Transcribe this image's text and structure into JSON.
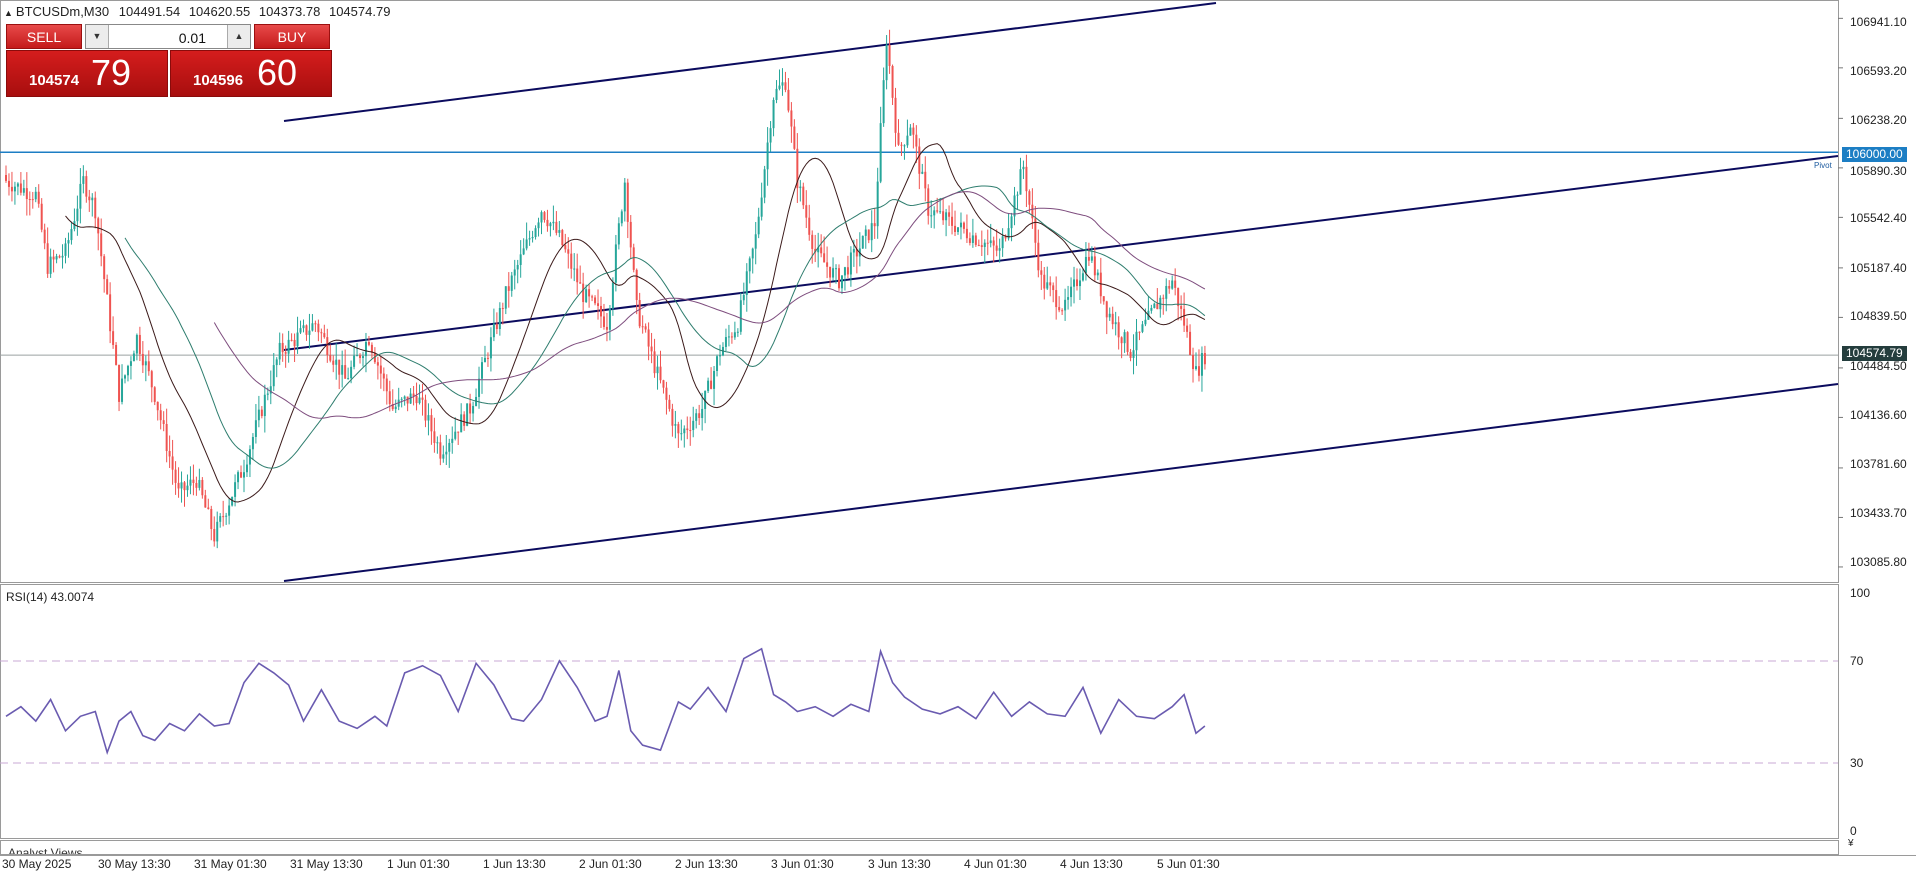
{
  "header": {
    "symbol": "BTCUSDm,M30",
    "collapse_icon": "triangle-up-icon",
    "ohlc": [
      "104491.54",
      "104620.55",
      "104373.78",
      "104574.79"
    ]
  },
  "trade_panel": {
    "sell_label": "SELL",
    "buy_label": "BUY",
    "lot_value": "0.01",
    "bid_small": "104574",
    "bid_big": "79",
    "ask_small": "104596",
    "ask_big": "60"
  },
  "colors": {
    "bull": "#26a69a",
    "bear": "#ef5350",
    "channel": "#0b0b5e",
    "pivot": "#1c7ec4",
    "ma_fast": "#3b1a1a",
    "ma_mid": "#2e7d6e",
    "ma_slow": "#7e4d7e",
    "rsi": "#6a5bb0",
    "current_price_tag": "#243d3d",
    "pivot_tag": "#1c7ec4"
  },
  "price_axis": {
    "labels": [
      "106941.10",
      "106593.20",
      "106238.20",
      "105890.30",
      "105542.40",
      "105187.40",
      "104839.50",
      "104484.50",
      "104136.60",
      "103781.60",
      "103433.70",
      "103085.80"
    ],
    "current_price": "104574.79",
    "pivot_price": "106000.00",
    "pivot_label": "Pivot"
  },
  "time_axis": {
    "labels": [
      "30 May 2025",
      "30 May 13:30",
      "31 May 01:30",
      "31 May 13:30",
      "1 Jun 01:30",
      "1 Jun 13:30",
      "2 Jun 01:30",
      "2 Jun 13:30",
      "3 Jun 01:30",
      "3 Jun 13:30",
      "4 Jun 01:30",
      "4 Jun 13:30",
      "5 Jun 01:30"
    ]
  },
  "rsi": {
    "title": "RSI(14) 43.0074",
    "levels": [
      "100",
      "70",
      "30",
      "0"
    ]
  },
  "bottom_tab": {
    "label": "Analyst Views"
  },
  "chart_data": [
    {
      "type": "candlestick",
      "title": "BTCUSDm,M30",
      "ylim": [
        102980,
        107070
      ],
      "key_closes": [
        [
          0,
          105800
        ],
        [
          10,
          105700
        ],
        [
          14,
          105200
        ],
        [
          20,
          105300
        ],
        [
          26,
          105800
        ],
        [
          30,
          105600
        ],
        [
          38,
          104300
        ],
        [
          44,
          104700
        ],
        [
          50,
          104300
        ],
        [
          58,
          103600
        ],
        [
          64,
          103700
        ],
        [
          70,
          103300
        ],
        [
          80,
          103800
        ],
        [
          92,
          104600
        ],
        [
          104,
          104800
        ],
        [
          114,
          104400
        ],
        [
          122,
          104700
        ],
        [
          130,
          104200
        ],
        [
          138,
          104300
        ],
        [
          146,
          103900
        ],
        [
          156,
          104200
        ],
        [
          168,
          105000
        ],
        [
          180,
          105600
        ],
        [
          186,
          105400
        ],
        [
          194,
          105000
        ],
        [
          202,
          104800
        ],
        [
          208,
          105800
        ],
        [
          212,
          104900
        ],
        [
          218,
          104500
        ],
        [
          226,
          104000
        ],
        [
          234,
          104200
        ],
        [
          240,
          104600
        ],
        [
          246,
          104800
        ],
        [
          252,
          105400
        ],
        [
          258,
          106400
        ],
        [
          262,
          106500
        ],
        [
          266,
          105800
        ],
        [
          272,
          105300
        ],
        [
          280,
          105100
        ],
        [
          286,
          105300
        ],
        [
          292,
          105500
        ],
        [
          296,
          106800
        ],
        [
          300,
          106000
        ],
        [
          304,
          106200
        ],
        [
          310,
          105600
        ],
        [
          318,
          105500
        ],
        [
          326,
          105400
        ],
        [
          334,
          105300
        ],
        [
          342,
          105900
        ],
        [
          348,
          105100
        ],
        [
          356,
          104900
        ],
        [
          364,
          105300
        ],
        [
          370,
          104900
        ],
        [
          378,
          104600
        ],
        [
          386,
          104900
        ],
        [
          392,
          105100
        ],
        [
          396,
          104800
        ],
        [
          400,
          104450
        ],
        [
          403,
          104575
        ]
      ]
    },
    {
      "type": "line",
      "title": "RSI(14) 43.0074",
      "ylim": [
        0,
        100
      ],
      "x": [
        0,
        5,
        10,
        15,
        20,
        25,
        30,
        34,
        38,
        42,
        46,
        50,
        55,
        60,
        65,
        70,
        75,
        80,
        85,
        90,
        95,
        100,
        106,
        112,
        118,
        124,
        128,
        134,
        140,
        146,
        152,
        158,
        164,
        170,
        174,
        180,
        186,
        192,
        198,
        202,
        206,
        210,
        214,
        220,
        226,
        230,
        236,
        242,
        248,
        254,
        258,
        262,
        266,
        272,
        278,
        284,
        290,
        294,
        298,
        302,
        308,
        314,
        320,
        326,
        332,
        338,
        344,
        350,
        356,
        362,
        368,
        374,
        380,
        386,
        392,
        396,
        400,
        403
      ],
      "values": [
        48,
        52,
        46,
        55,
        42,
        48,
        50,
        33,
        46,
        50,
        40,
        38,
        45,
        42,
        49,
        44,
        45,
        62,
        70,
        66,
        61,
        46,
        59,
        46,
        43,
        48,
        44,
        66,
        69,
        65,
        50,
        70,
        61,
        47,
        46,
        55,
        71,
        60,
        46,
        48,
        67,
        42,
        36,
        34,
        54,
        51,
        60,
        50,
        72,
        76,
        57,
        54,
        50,
        52,
        48,
        53,
        50,
        75,
        62,
        56,
        51,
        49,
        52,
        47,
        58,
        48,
        54,
        49,
        48,
        60,
        41,
        55,
        48,
        47,
        52,
        57,
        41,
        44
      ],
      "levels": [
        70,
        30
      ]
    }
  ]
}
